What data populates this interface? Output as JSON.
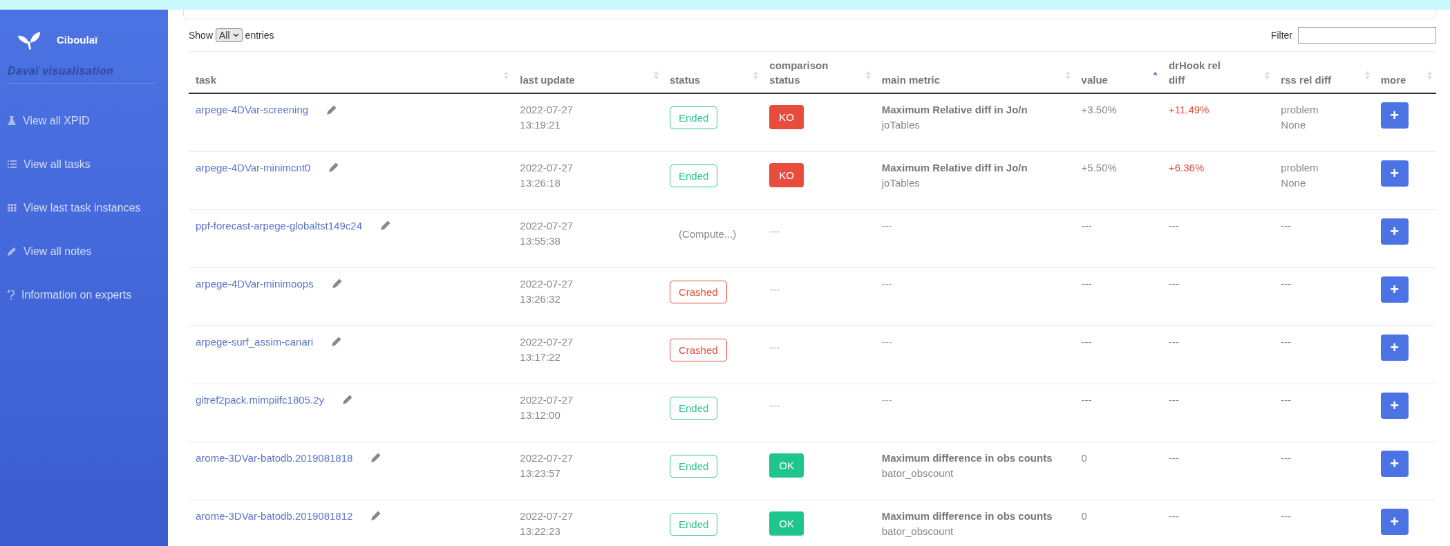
{
  "sidebar": {
    "brand": "Ciboulaï",
    "subtitle": "Davaï visualisation",
    "items": [
      {
        "kind": "flask",
        "label": "View all XPID"
      },
      {
        "kind": "list",
        "label": "View all tasks"
      },
      {
        "kind": "grid",
        "label": "View last task instances"
      },
      {
        "kind": "pencil",
        "label": "View all notes"
      },
      {
        "kind": "question",
        "label": "Information on experts"
      }
    ]
  },
  "controls": {
    "show_label": "Show",
    "page_size": "All",
    "entries_label": "entries",
    "filter_label": "Filter"
  },
  "table": {
    "columns": [
      {
        "label": "task",
        "sorted": false
      },
      {
        "label": "last update",
        "sorted": false
      },
      {
        "label": "status",
        "sorted": false
      },
      {
        "label": "comparison status",
        "sorted": false
      },
      {
        "label": "main metric",
        "sorted": false
      },
      {
        "label": "value",
        "sorted": true
      },
      {
        "label": "drHook rel diff",
        "sorted": false
      },
      {
        "label": "rss rel diff",
        "sorted": false
      },
      {
        "label": "more",
        "sorted": false
      }
    ],
    "rows": [
      {
        "task": "arpege-4DVar-screening",
        "date": "2022-07-27",
        "time": "13:19:21",
        "status": {
          "kind": "ended",
          "label": "Ended"
        },
        "comparison": {
          "kind": "ko",
          "label": "KO"
        },
        "metric": {
          "kind": "metric",
          "title": "Maximum Relative diff in Jo/n",
          "source": "joTables"
        },
        "value": "+3.50%",
        "drhook": {
          "label": "+11.49%",
          "alert": true
        },
        "rss": [
          "problem",
          "None"
        ],
        "more": "+"
      },
      {
        "task": "arpege-4DVar-minimcnt0",
        "date": "2022-07-27",
        "time": "13:26:18",
        "status": {
          "kind": "ended",
          "label": "Ended"
        },
        "comparison": {
          "kind": "ko",
          "label": "KO"
        },
        "metric": {
          "kind": "metric",
          "title": "Maximum Relative diff in Jo/n",
          "source": "joTables"
        },
        "value": "+5.50%",
        "drhook": {
          "label": "+6.36%",
          "alert": true
        },
        "rss": [
          "problem",
          "None"
        ],
        "more": "+"
      },
      {
        "task": "ppf-forecast-arpege-globaltst149c24",
        "date": "2022-07-27",
        "time": "13:55:38",
        "status": {
          "kind": "computing",
          "label": "(Compute...)"
        },
        "comparison": {
          "kind": "none",
          "label": "---"
        },
        "metric": {
          "kind": "empty",
          "title": "---"
        },
        "value": "---",
        "drhook": {
          "label": "---",
          "alert": false
        },
        "rss": [
          "---"
        ],
        "more": "+"
      },
      {
        "task": "arpege-4DVar-minimoops",
        "date": "2022-07-27",
        "time": "13:26:32",
        "status": {
          "kind": "crashed",
          "label": "Crashed"
        },
        "comparison": {
          "kind": "none",
          "label": "---"
        },
        "metric": {
          "kind": "empty",
          "title": "---"
        },
        "value": "---",
        "drhook": {
          "label": "---",
          "alert": false
        },
        "rss": [
          "---"
        ],
        "more": "+"
      },
      {
        "task": "arpege-surf_assim-canari",
        "date": "2022-07-27",
        "time": "13:17:22",
        "status": {
          "kind": "crashed",
          "label": "Crashed"
        },
        "comparison": {
          "kind": "none",
          "label": "---"
        },
        "metric": {
          "kind": "empty",
          "title": "---"
        },
        "value": "---",
        "drhook": {
          "label": "---",
          "alert": false
        },
        "rss": [
          "---"
        ],
        "more": "+"
      },
      {
        "task": "gitref2pack.mimpiifc1805.2y",
        "date": "2022-07-27",
        "time": "13:12:00",
        "status": {
          "kind": "ended",
          "label": "Ended"
        },
        "comparison": {
          "kind": "none",
          "label": "---"
        },
        "metric": {
          "kind": "empty",
          "title": "---"
        },
        "value": "---",
        "drhook": {
          "label": "---",
          "alert": false
        },
        "rss": [
          "---"
        ],
        "more": "+"
      },
      {
        "task": "arome-3DVar-batodb.2019081818",
        "date": "2022-07-27",
        "time": "13:23:57",
        "status": {
          "kind": "ended",
          "label": "Ended"
        },
        "comparison": {
          "kind": "ok",
          "label": "OK"
        },
        "metric": {
          "kind": "metric",
          "title": "Maximum difference in obs counts",
          "source": "bator_obscount"
        },
        "value": "0",
        "drhook": {
          "label": "---",
          "alert": false
        },
        "rss": [
          "---"
        ],
        "more": "+"
      },
      {
        "task": "arome-3DVar-batodb.2019081812",
        "date": "2022-07-27",
        "time": "13:22:23",
        "status": {
          "kind": "ended",
          "label": "Ended"
        },
        "comparison": {
          "kind": "ok",
          "label": "OK"
        },
        "metric": {
          "kind": "metric",
          "title": "Maximum difference in obs counts",
          "source": "bator_obscount"
        },
        "value": "0",
        "drhook": {
          "label": "---",
          "alert": false
        },
        "rss": [
          "---"
        ],
        "more": "+"
      }
    ]
  }
}
